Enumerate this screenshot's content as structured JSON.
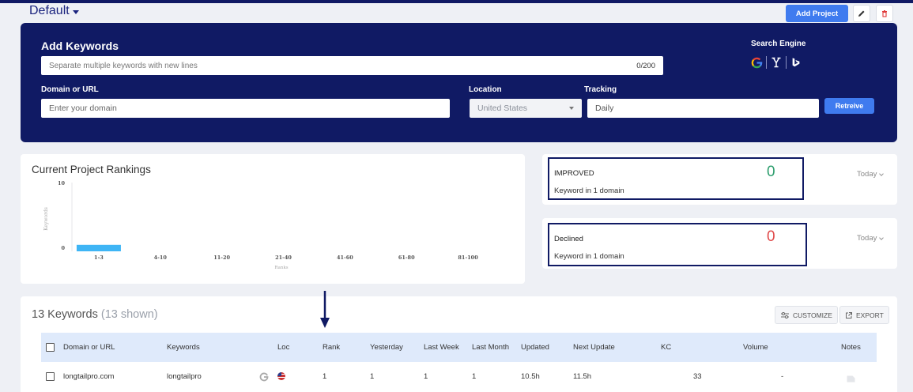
{
  "header": {
    "project_name": "Default",
    "add_project_label": "Add Project"
  },
  "add_keywords": {
    "title": "Add Keywords",
    "keywords_placeholder": "Separate multiple keywords with new lines",
    "keywords_counter": "0/200",
    "domain_label": "Domain or URL",
    "domain_placeholder": "Enter your domain",
    "location_label": "Location",
    "location_value": "United States",
    "tracking_label": "Tracking",
    "tracking_value": "Daily",
    "retrieve_label": "Retreive",
    "search_engine_label": "Search Engine",
    "search_engines": [
      "google-icon",
      "yahoo-icon",
      "bing-icon"
    ]
  },
  "rankings": {
    "title": "Current Project Rankings"
  },
  "chart_data": {
    "type": "bar",
    "title": "Current Project Rankings",
    "categories": [
      "1-3",
      "4-10",
      "11-20",
      "21-40",
      "41-60",
      "61-80",
      "81-100"
    ],
    "values": [
      1,
      0,
      0,
      0,
      0,
      0,
      0
    ],
    "xlabel": "Ranks",
    "ylabel": "Keywords",
    "ylim": [
      0,
      10
    ],
    "yticks": [
      "10",
      "0"
    ],
    "bar_color": "#3fb5f5",
    "grid": false
  },
  "improved": {
    "label": "IMPROVED",
    "value": "0",
    "subtitle": "Keyword in 1 domain",
    "period": "Today",
    "color": "#2e9e6e"
  },
  "declined": {
    "label": "Declined",
    "value": "0",
    "subtitle": "Keyword in 1 domain",
    "period": "Today",
    "color": "#e04a4a"
  },
  "keywords_table": {
    "count_label": "13 Keywords",
    "shown_label": "(13 shown)",
    "customize_label": "CUSTOMIZE",
    "export_label": "EXPORT",
    "columns": [
      "Domain or URL",
      "Keywords",
      "Loc",
      "Rank",
      "Yesterday",
      "Last Week",
      "Last Month",
      "Updated",
      "Next Update",
      "KC",
      "Volume",
      "Notes"
    ],
    "rows": [
      {
        "domain": "longtailpro.com",
        "keyword": "longtailpro",
        "engine": "google-icon",
        "loc": "us-flag-icon",
        "rank": "1",
        "yesterday": "1",
        "last_week": "1",
        "last_month": "1",
        "updated": "10.5h",
        "next_update": "11.5h",
        "kc": "33",
        "volume": "-",
        "notes": "note-icon"
      }
    ]
  }
}
